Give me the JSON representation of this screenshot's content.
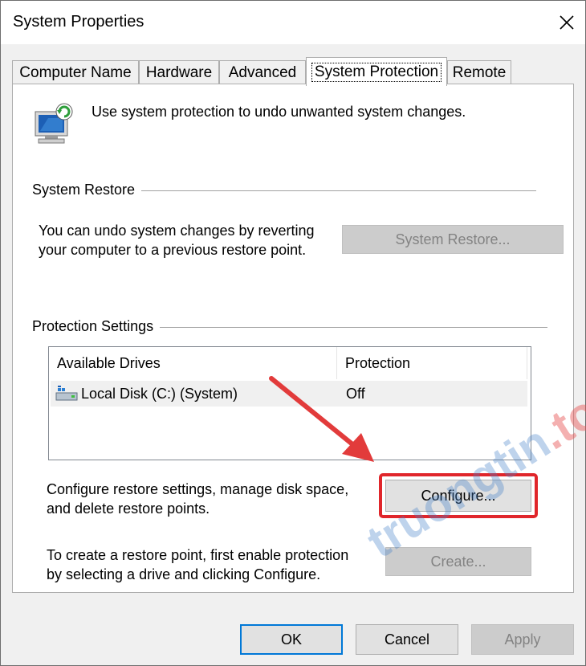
{
  "window": {
    "title": "System Properties"
  },
  "tabs": [
    {
      "label": "Computer Name"
    },
    {
      "label": "Hardware"
    },
    {
      "label": "Advanced"
    },
    {
      "label": "System Protection"
    },
    {
      "label": "Remote"
    }
  ],
  "intro": {
    "text": "Use system protection to undo unwanted system changes."
  },
  "system_restore": {
    "group_label": "System Restore",
    "description_line1": "You can undo system changes by reverting",
    "description_line2": "your computer to a previous restore point.",
    "button_label": "System Restore..."
  },
  "protection_settings": {
    "group_label": "Protection Settings",
    "columns": [
      "Available Drives",
      "Protection"
    ],
    "rows": [
      {
        "drive": "Local Disk (C:) (System)",
        "protection": "Off"
      }
    ],
    "configure_text_line1": "Configure restore settings, manage disk space,",
    "configure_text_line2": "and delete restore points.",
    "configure_button": "Configure...",
    "create_text_line1": "To create a restore point, first enable protection",
    "create_text_line2": "by selecting a drive and clicking Configure.",
    "create_button": "Create..."
  },
  "footer": {
    "ok": "OK",
    "cancel": "Cancel",
    "apply": "Apply"
  },
  "watermark": {
    "main": "truongtin",
    "dot": ".top"
  },
  "colors": {
    "highlight_box": "#e0262b",
    "arrow": "#e23b3b",
    "default_button_border": "#0078d7"
  }
}
